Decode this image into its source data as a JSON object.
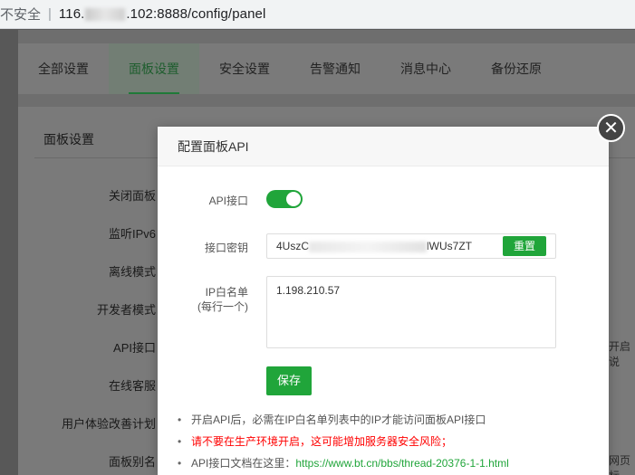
{
  "address_bar": {
    "security_label": "不安全",
    "url_prefix": "116.",
    "url_suffix": ".102:8888/config/panel"
  },
  "tabs": [
    {
      "label": "全部设置"
    },
    {
      "label": "面板设置"
    },
    {
      "label": "安全设置"
    },
    {
      "label": "告警通知"
    },
    {
      "label": "消息中心"
    },
    {
      "label": "备份还原"
    }
  ],
  "panel": {
    "title": "面板设置",
    "rows": [
      {
        "label": "关闭面板"
      },
      {
        "label": "监听IPv6"
      },
      {
        "label": "离线模式"
      },
      {
        "label": "开发者模式"
      },
      {
        "label": "API接口"
      },
      {
        "label": "在线客服"
      },
      {
        "label": "用户体验改善计划"
      },
      {
        "label": "面板别名"
      }
    ],
    "right_fragments": [
      "开启说",
      "网页标"
    ]
  },
  "modal": {
    "title": "配置面板API",
    "api_label": "API接口",
    "api_enabled": true,
    "key_label": "接口密钥",
    "key_start": "4UszC",
    "key_end": "lWUs7ZT",
    "reset_label": "重置",
    "ip_label_line1": "IP白名单",
    "ip_label_line2": "(每行一个)",
    "ip_whitelist": "1.198.210.57",
    "save_label": "保存",
    "notes": [
      {
        "text": "开启API后，必需在IP白名单列表中的IP才能访问面板API接口",
        "warn": false
      },
      {
        "text": "请不要在生产环境开启，这可能增加服务器安全风险；",
        "warn": true
      },
      {
        "text": "API接口文档在这里：",
        "link": "https://www.bt.cn/bbs/thread-20376-1-1.html",
        "warn": false
      }
    ]
  },
  "colors": {
    "accent": "#20a53a",
    "warn": "#ff0000"
  }
}
